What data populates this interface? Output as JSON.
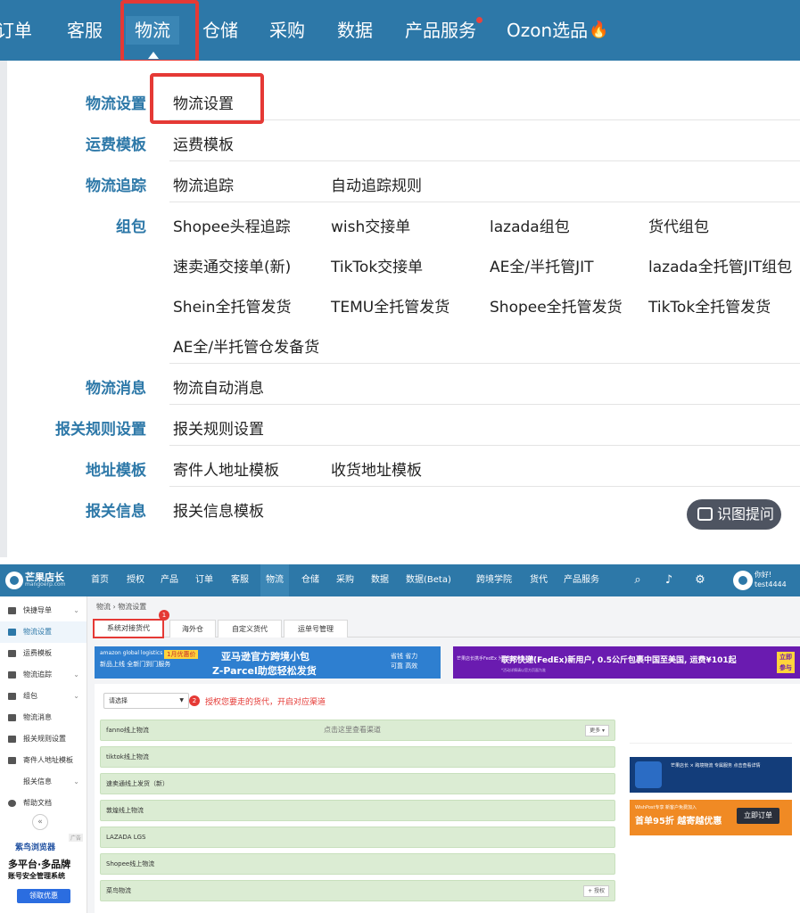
{
  "top": {
    "nav": [
      "订单",
      "客服",
      "物流",
      "仓储",
      "采购",
      "数据",
      "产品服务",
      "Ozon选品"
    ],
    "active_nav": "物流",
    "fire_icon": "🔥",
    "menu": {
      "logistics_settings": {
        "label": "物流设置",
        "links": [
          "物流设置"
        ]
      },
      "freight_template": {
        "label": "运费模板",
        "links": [
          "运费模板"
        ]
      },
      "logistics_tracking": {
        "label": "物流追踪",
        "links": [
          "物流追踪",
          "自动追踪规则"
        ]
      },
      "packaging": {
        "label": "组包",
        "links": [
          "Shopee头程追踪",
          "wish交接单",
          "lazada组包",
          "货代组包",
          "速卖通交接单(新)",
          "TikTok交接单",
          "AE全/半托管JIT",
          "lazada全托管JIT组包",
          "Shein全托管发货",
          "TEMU全托管发货",
          "Shopee全托管发货",
          "TikTok全托管发货",
          "AE全/半托管仓发备货"
        ]
      },
      "logistics_message": {
        "label": "物流消息",
        "links": [
          "物流自动消息"
        ]
      },
      "customs_rules": {
        "label": "报关规则设置",
        "links": [
          "报关规则设置"
        ]
      },
      "address_template": {
        "label": "地址模板",
        "links": [
          "寄件人地址模板",
          "收货地址模板"
        ]
      },
      "customs_info": {
        "label": "报关信息",
        "links": [
          "报关信息模板"
        ]
      }
    },
    "ask_button": "识图提问"
  },
  "app": {
    "logo": {
      "name": "芒果店长",
      "sub": "mangoerp.com"
    },
    "nav": [
      "首页",
      "授权",
      "产品",
      "订单",
      "客服",
      "物流",
      "仓储",
      "采购",
      "数据",
      "数据(Beta)",
      "跨境学院",
      "货代",
      "产品服务"
    ],
    "active_nav": "物流",
    "user": {
      "line1": "你好!",
      "line2": "test4444"
    },
    "sidebar": [
      "快捷导单",
      "物流设置",
      "运费模板",
      "物流追踪",
      "组包",
      "物流消息",
      "报关规则设置",
      "寄件人地址模板",
      "报关信息",
      "帮助文档"
    ],
    "sidebar_ad": {
      "tag": "广告",
      "brand": "紫鸟浏览器",
      "line1": "多平台·多品牌",
      "line2": "账号安全管理系统",
      "button": "领取优惠"
    },
    "breadcrumb": "物流 › 物流设置",
    "tabs": [
      "系统对接货代",
      "海外仓",
      "自定义货代",
      "运单号管理"
    ],
    "step1": "1",
    "step2": "2",
    "banner1": {
      "brand": "amazon global logistics",
      "tag": "1月优惠价",
      "left_text": "新品上线 全新门到门服务",
      "title": "亚马逊官方跨境小包",
      "title2": "Z-Parcel助您轻松发货",
      "right_text": "省钱 省力\n可靠 高效"
    },
    "banner2": {
      "small": "芒果店长携手FedEx 为您节省大量费用!",
      "title": "联邦快递(FedEx)新用户, 0.5公斤包裹中国至美国, 运费¥101起",
      "fine": "*活动详情请以官方页面为准",
      "cta": "立即参与"
    },
    "select_placeholder": "请选择",
    "hint": "授权您要走的货代，开启对应渠道",
    "channels": [
      "fanno线上物流",
      "tiktok线上物流",
      "速卖通线上发货（新）",
      "敦煌线上物流",
      "LAZADA LGS",
      "Shopee线上物流",
      "菜鸟物流"
    ],
    "channel_center_text": "点击这里查看渠道",
    "more_button": "更多 ▾",
    "auth_button": "+ 授权",
    "side_ad1_text": "芒果店长 × 跨境物流 专属服务 点击查看详情",
    "side_ad2": {
      "small": "WishPost专享 新客户免费加入",
      "title": "首单95折 越寄越优惠",
      "button": "立即订单"
    }
  },
  "colors": {
    "primary": "#2d78a8",
    "highlight": "#e53935",
    "channel_row": "#dbecd3"
  }
}
